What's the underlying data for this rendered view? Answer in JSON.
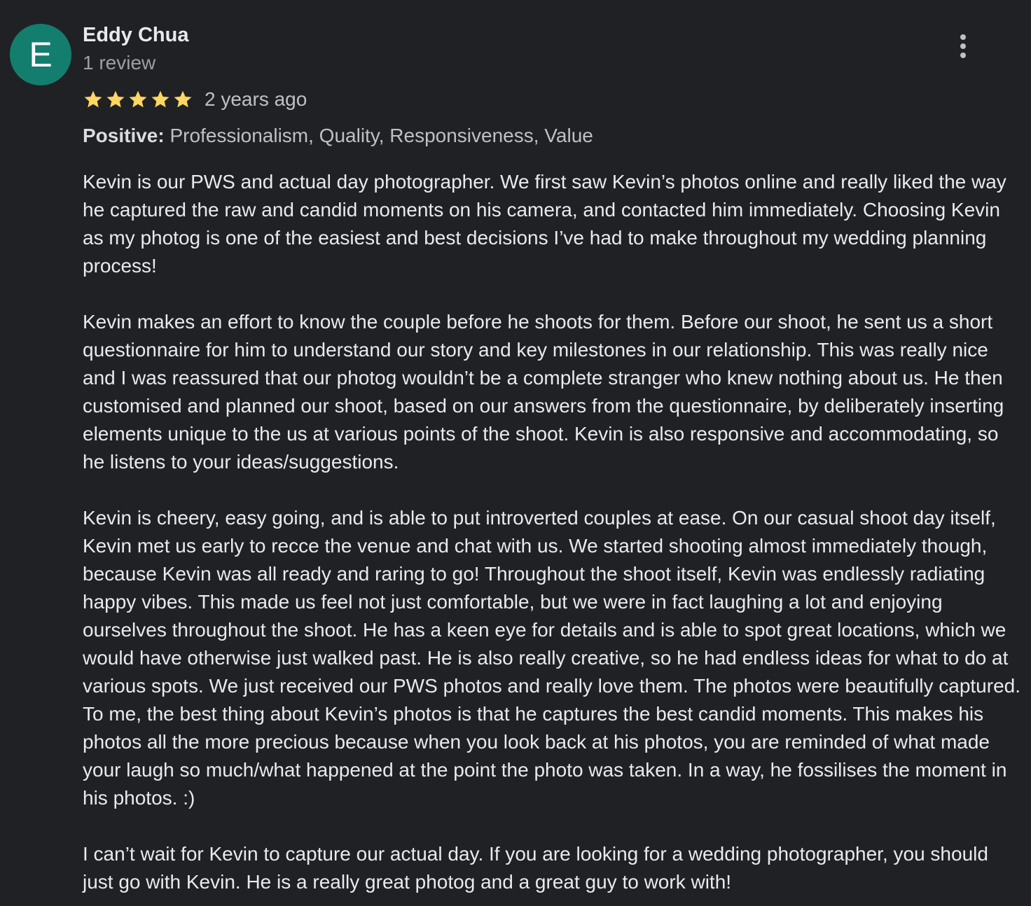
{
  "review": {
    "author_name": "Eddy Chua",
    "author_initial": "E",
    "avatar_color": "#137e6e",
    "review_count": "1 review",
    "rating": 5,
    "rating_max": 5,
    "star_color": "#fdd663",
    "time_ago": "2 years ago",
    "attributes_label": "Positive:",
    "attributes_text": " Professionalism, Quality, Responsiveness, Value",
    "more_icon": "more-vertical-icon",
    "paragraphs": [
      "Kevin is our PWS and actual day photographer. We first saw Kevin’s photos online and really liked the way he captured the raw and candid moments on his camera, and contacted him immediately. Choosing Kevin as my photog is one of the easiest and best decisions I’ve had to make throughout my wedding planning process!",
      "Kevin makes an effort to know the couple before he shoots for them. Before our shoot, he sent us a short questionnaire for him to understand our story and key milestones in our relationship. This was really nice and I was reassured that our photog wouldn’t be a complete stranger who knew nothing about us. He then customised and planned our shoot, based on our answers from the questionnaire, by deliberately inserting elements unique to the us at various points of the shoot. Kevin is also responsive and accommodating, so he listens to your ideas/suggestions.",
      "Kevin is cheery, easy going, and is able to put introverted couples at ease. On our casual shoot day itself, Kevin met us early to recce the venue and chat with us. We started shooting almost immediately though, because Kevin was all ready and raring to go! Throughout the shoot itself, Kevin was endlessly radiating happy vibes. This made us feel not just comfortable, but we were in fact laughing a lot and enjoying ourselves throughout the shoot. He has a keen eye for details and is able to spot great locations, which we would have otherwise just walked past. He is also really creative, so he had endless ideas for what to do at various spots. We just received our PWS photos and really love them. The photos were beautifully captured. To me, the best thing about Kevin’s photos is that he captures the best candid moments. This makes his photos all the more precious because when you look back at his photos, you are reminded of what made your laugh so much/what happened at the point the photo was taken. In a way, he fossilises the moment in his photos. :)",
      "I can’t wait for Kevin to capture our actual day. If you are looking for a wedding photographer, you should just go with Kevin. He is a really great photog and a great guy to work with!"
    ]
  }
}
